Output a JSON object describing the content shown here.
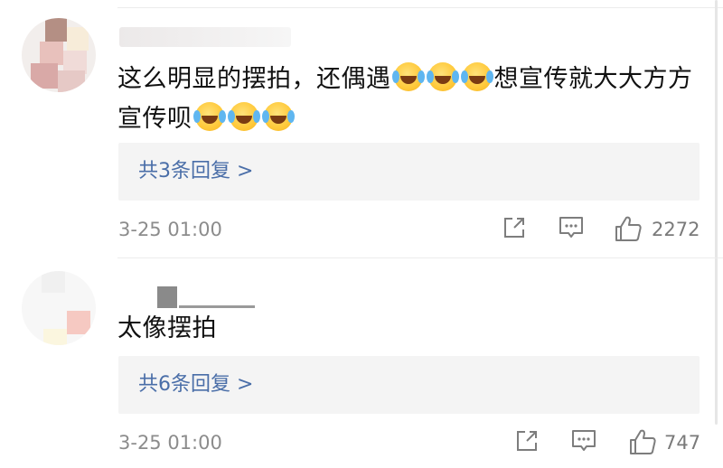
{
  "comments": [
    {
      "text_part1": "这么明显的摆拍，还偶遇",
      "text_part2": "想宣传就大大方方宣传呗",
      "replies_label": "共3条回复 >",
      "time": "3-25 01:00",
      "likes": "2272"
    },
    {
      "text": "太像摆拍",
      "replies_label": "共6条回复 >",
      "time": "3-25 01:00",
      "likes": "747"
    }
  ],
  "icons": {
    "emoji": "laughing-crying-emoji",
    "share": "share-icon",
    "comment": "comment-icon",
    "like": "thumbs-up-icon"
  },
  "colors": {
    "link": "#4a6ea8",
    "reply_bg": "#f4f4f4",
    "meta": "#8c8c8c"
  }
}
